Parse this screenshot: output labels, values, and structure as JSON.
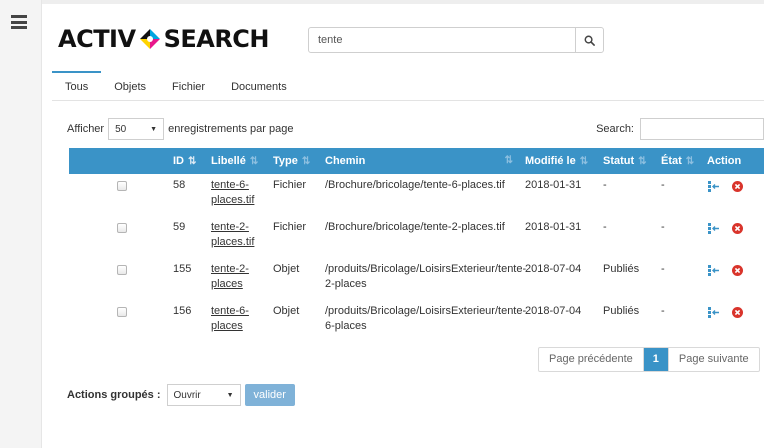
{
  "brand": {
    "left": "ACTIV",
    "right": "SEARCH"
  },
  "search": {
    "value": "tente",
    "icon": "search-icon"
  },
  "tabs": [
    {
      "label": "Tous",
      "active": true
    },
    {
      "label": "Objets",
      "active": false
    },
    {
      "label": "Fichier",
      "active": false
    },
    {
      "label": "Documents",
      "active": false
    }
  ],
  "controls": {
    "show_label": "Afficher",
    "page_length": "50",
    "per_page_label": "enregistrements par page",
    "search_label": "Search:"
  },
  "table": {
    "headers": {
      "id": "ID",
      "label": "Libellé",
      "type": "Type",
      "path": "Chemin",
      "modified": "Modifié le",
      "status": "Statut",
      "state": "État",
      "action": "Action"
    },
    "rows": [
      {
        "id": "58",
        "label": "tente-6-places.tif",
        "type": "Fichier",
        "path": "/Brochure/bricolage/tente-6-places.tif",
        "modified": "2018-01-31",
        "status": "-",
        "state": "-"
      },
      {
        "id": "59",
        "label": "tente-2-places.tif",
        "type": "Fichier",
        "path": "/Brochure/bricolage/tente-2-places.tif",
        "modified": "2018-01-31",
        "status": "-",
        "state": "-"
      },
      {
        "id": "155",
        "label": "tente-2-places",
        "type": "Objet",
        "path": "/produits/Bricolage/LoisirsExterieur/tente-2-places",
        "modified": "2018-07-04",
        "status": "Publiés",
        "state": "-"
      },
      {
        "id": "156",
        "label": "tente-6-places",
        "type": "Objet",
        "path": "/produits/Bricolage/LoisirsExterieur/tente-6-places",
        "modified": "2018-07-04",
        "status": "Publiés",
        "state": "-"
      }
    ]
  },
  "pagination": {
    "prev": "Page précédente",
    "current": "1",
    "next": "Page suivante"
  },
  "bulk": {
    "label": "Actions groupés :",
    "selected": "Ouvrir",
    "submit": "valider"
  },
  "colors": {
    "accent": "#3a93c7",
    "delete": "#d9342b",
    "submit": "#7fb2d8"
  }
}
